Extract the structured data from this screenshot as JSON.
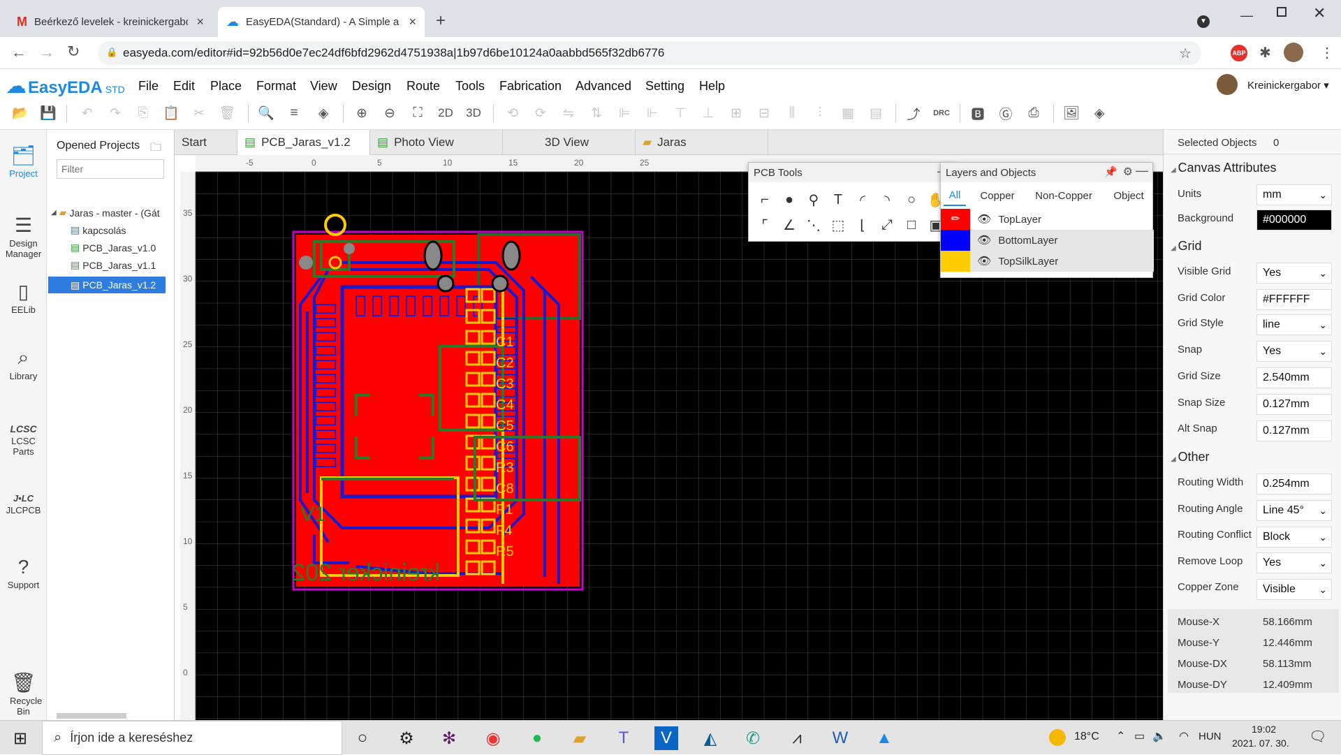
{
  "browser": {
    "tabs": [
      {
        "title": "Beérkező levelek - kreinickergabo",
        "icon": "gmail-icon"
      },
      {
        "title": "EasyEDA(Standard) - A Simple an",
        "icon": "easyeda-icon"
      }
    ],
    "url": "easyeda.com/editor#id=92b56d0e7ec24df6bfd2962d4751938a|1b97d6be10124a0aabbd565f32db6776",
    "extension_badge": "ABP"
  },
  "app": {
    "logo": "EasyEDA",
    "logo_suffix": "STD",
    "menu": [
      "File",
      "Edit",
      "Place",
      "Format",
      "View",
      "Design",
      "Route",
      "Tools",
      "Fabrication",
      "Advanced",
      "Setting",
      "Help"
    ],
    "user": "Kreinickergabor",
    "toolbar_2d": "2D",
    "toolbar_3d": "3D",
    "toolbar_drc": "DRC"
  },
  "leftnav": [
    {
      "label": "Project",
      "icon": "folder-icon"
    },
    {
      "label": "Design Manager",
      "icon": "list-icon"
    },
    {
      "label": "EELib",
      "icon": "chip-icon"
    },
    {
      "label": "Library",
      "icon": "search-library-icon"
    },
    {
      "label": "LCSC Parts",
      "icon": "lcsc-icon"
    },
    {
      "label": "JLCPCB",
      "icon": "jlc-icon"
    },
    {
      "label": "Support",
      "icon": "help-icon"
    },
    {
      "label": "Recycle Bin",
      "icon": "trash-icon"
    }
  ],
  "projects": {
    "title": "Opened Projects",
    "filter_placeholder": "Filter",
    "root": "Jaras - master - (Gát",
    "items": [
      "kapcsolás",
      "PCB_Jaras_v1.0",
      "PCB_Jaras_v1.1",
      "PCB_Jaras_v1.2"
    ],
    "selected": "PCB_Jaras_v1.2"
  },
  "doc_tabs": [
    "Start",
    "PCB_Jaras_v1.2",
    "Photo View",
    "3D View",
    "Jaras"
  ],
  "ruler": {
    "top": [
      "-5",
      "0",
      "5",
      "10",
      "15",
      "20",
      "25"
    ],
    "left": [
      "35",
      "30",
      "25",
      "20",
      "15",
      "10",
      "5",
      "0"
    ]
  },
  "pcb_tools": {
    "title": "PCB Tools"
  },
  "layers": {
    "title": "Layers and Objects",
    "tabs": [
      "All",
      "Copper",
      "Non-Copper",
      "Object"
    ],
    "rows": [
      {
        "name": "TopLayer",
        "color": "#ff0000"
      },
      {
        "name": "BottomLayer",
        "color": "#0000ff"
      },
      {
        "name": "TopSilkLayer",
        "color": "#ffcc00"
      }
    ]
  },
  "silk_text": [
    "C1",
    "C2",
    "C3",
    "C4",
    "C5",
    "C6",
    "R3",
    "C8",
    "P1",
    "F4",
    "R5",
    "V1",
    "kreinicker 202"
  ],
  "right": {
    "selected_label": "Selected Objects",
    "selected_count": "0",
    "canvas_title": "Canvas Attributes",
    "units_label": "Units",
    "units": "mm",
    "bg_label": "Background",
    "bg": "#000000",
    "grid_title": "Grid",
    "visible_grid_label": "Visible Grid",
    "visible_grid": "Yes",
    "grid_color_label": "Grid Color",
    "grid_color": "#FFFFFF",
    "grid_style_label": "Grid Style",
    "grid_style": "line",
    "snap_label": "Snap",
    "snap": "Yes",
    "grid_size_label": "Grid Size",
    "grid_size": "2.540mm",
    "snap_size_label": "Snap Size",
    "snap_size": "0.127mm",
    "alt_snap_label": "Alt Snap",
    "alt_snap": "0.127mm",
    "other_title": "Other",
    "routing_width_label": "Routing Width",
    "routing_width": "0.254mm",
    "routing_angle_label": "Routing Angle",
    "routing_angle": "Line 45°",
    "routing_conflict_label": "Routing Conflict",
    "routing_conflict": "Block",
    "remove_loop_label": "Remove Loop",
    "remove_loop": "Yes",
    "copper_zone_label": "Copper Zone",
    "copper_zone": "Visible",
    "mouse_x_label": "Mouse-X",
    "mouse_x": "58.166mm",
    "mouse_y_label": "Mouse-Y",
    "mouse_y": "12.446mm",
    "mouse_dx_label": "Mouse-DX",
    "mouse_dx": "58.113mm",
    "mouse_dy_label": "Mouse-DY",
    "mouse_dy": "12.409mm"
  },
  "taskbar": {
    "search_placeholder": "Írjon ide a kereséshez",
    "temperature": "18°C",
    "language": "HUN",
    "time": "19:02",
    "date": "2021. 07. 30."
  }
}
